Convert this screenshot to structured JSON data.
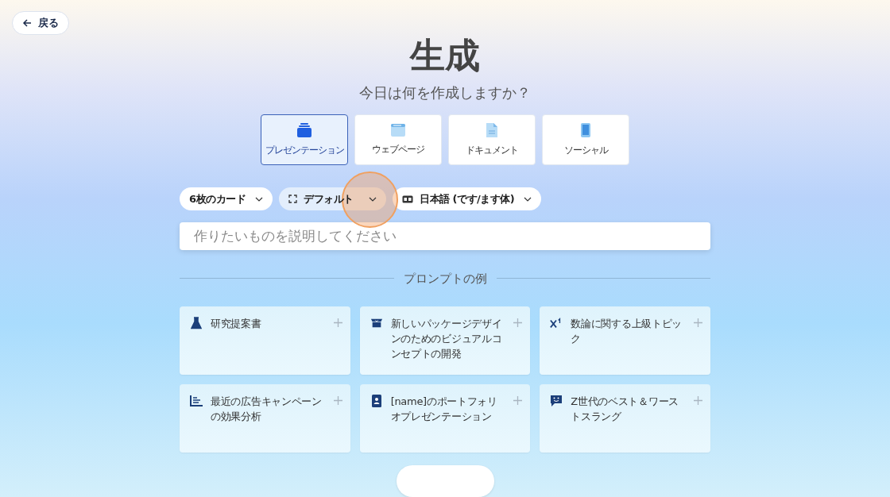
{
  "back_button": {
    "label": "戻る"
  },
  "title": "生成",
  "subtitle": "今日は何を作成しますか？",
  "types": [
    {
      "label": "プレゼンテーション",
      "kind": "presentation",
      "selected": true
    },
    {
      "label": "ウェブページ",
      "kind": "webpage",
      "selected": false
    },
    {
      "label": "ドキュメント",
      "kind": "document",
      "selected": false
    },
    {
      "label": "ソーシャル",
      "kind": "social",
      "selected": false
    }
  ],
  "options": [
    {
      "label": "6枚のカード",
      "kind": "cards",
      "pressed": false
    },
    {
      "label": "デフォルト",
      "kind": "format",
      "pressed": true
    },
    {
      "label": "日本語 (です/ます体)",
      "kind": "language",
      "pressed": false
    }
  ],
  "prompt": {
    "placeholder": "作りたいものを説明してください"
  },
  "examples_heading": "プロンプトの例",
  "examples": [
    {
      "text": "研究提案書",
      "kind": "flask"
    },
    {
      "text": "新しいパッケージデザインのためのビジュアルコンセプトの開発",
      "kind": "box"
    },
    {
      "text": "数論に関する上級トピック",
      "kind": "superscript"
    },
    {
      "text": "最近の広告キャンペーンの効果分析",
      "kind": "chart"
    },
    {
      "text": "[name]のポートフォリオプレゼンテーション",
      "kind": "badge"
    },
    {
      "text": "Z世代のベスト＆ワーストスラング",
      "kind": "chat"
    }
  ]
}
